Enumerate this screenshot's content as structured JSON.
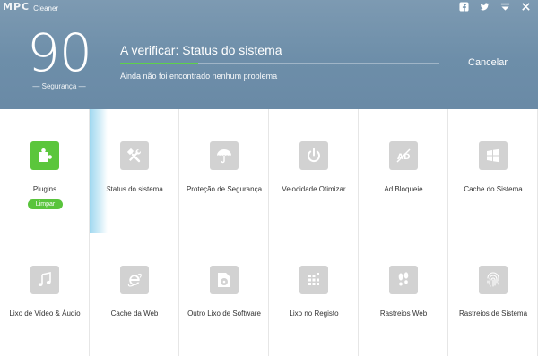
{
  "app": {
    "logo_mark": "MPC",
    "logo_text": "Cleaner"
  },
  "header_icons": [
    {
      "name": "facebook-icon"
    },
    {
      "name": "twitter-icon"
    },
    {
      "name": "menu-icon"
    },
    {
      "name": "close-icon"
    }
  ],
  "score": {
    "value": "90",
    "label": "— Segurança —"
  },
  "scan": {
    "title": "A verificar: Status do sistema",
    "subtitle": "Ainda não foi encontrado nenhum problema",
    "progress": 0.245,
    "cancel_label": "Cancelar",
    "progress_color": "#5ed14a"
  },
  "tiles": [
    {
      "label": "Plugins",
      "icon": "puzzle-icon",
      "active": true,
      "button": "Limpar"
    },
    {
      "label": "Status do sistema",
      "icon": "tools-icon"
    },
    {
      "label": "Proteção de Segurança",
      "icon": "umbrella-icon"
    },
    {
      "label": "Velocidade Otimizar",
      "icon": "power-icon"
    },
    {
      "label": "Ad Bloqueie",
      "icon": "ad-block-icon"
    },
    {
      "label": "Cache do Sistema",
      "icon": "windows-icon"
    },
    {
      "label": "Lixo de Vídeo & Áudio",
      "icon": "music-note-icon"
    },
    {
      "label": "Cache da Web",
      "icon": "internet-explorer-icon"
    },
    {
      "label": "Outro Lixo de Software",
      "icon": "disc-icon"
    },
    {
      "label": "Lixo no Registo",
      "icon": "registry-grid-icon"
    },
    {
      "label": "Rastreios Web",
      "icon": "footprints-icon"
    },
    {
      "label": "Rastreios de Sistema",
      "icon": "fingerprint-icon"
    }
  ],
  "colors": {
    "header_bg": "#6d8ea9",
    "accent_green": "#5bc63c",
    "icon_gray": "#d2d2d2"
  }
}
